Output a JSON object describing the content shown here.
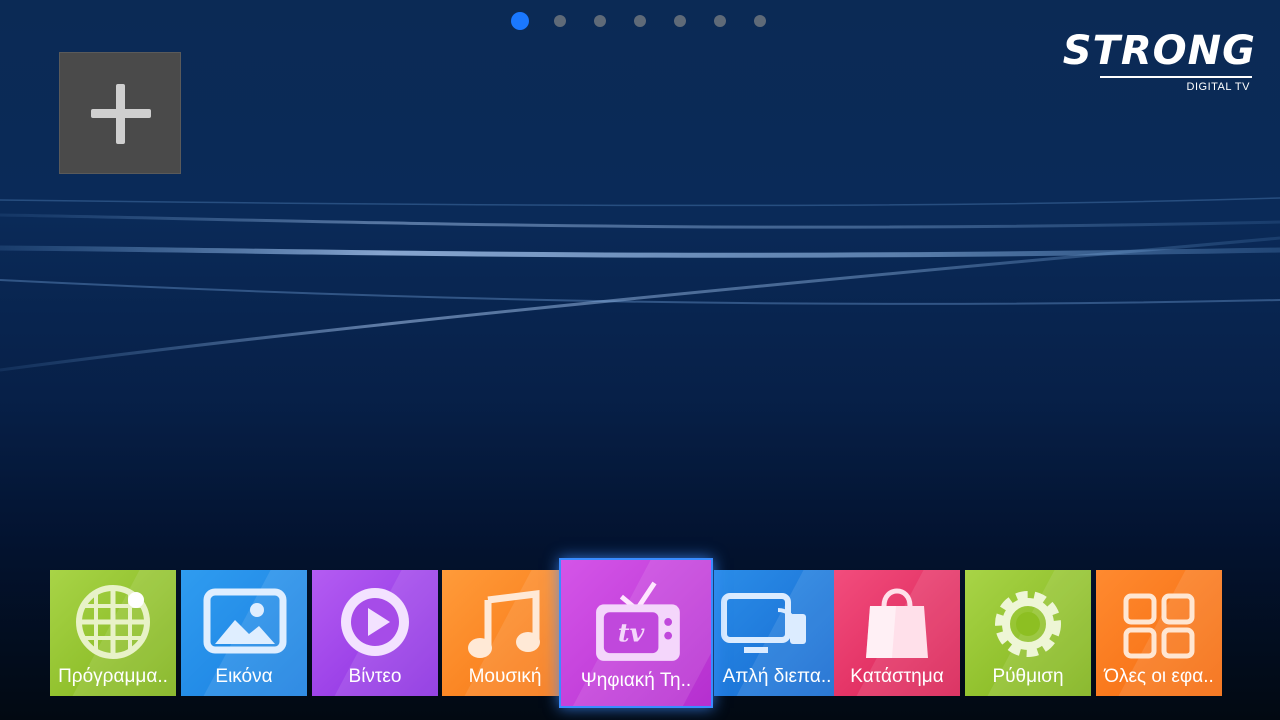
{
  "page_indicator": {
    "count": 7,
    "active_index": 0
  },
  "add_tile": {
    "icon": "plus-icon"
  },
  "logo": {
    "brand": "STRONG",
    "subtitle": "DIGITAL TV"
  },
  "dock": {
    "focused_index": 4,
    "apps": [
      {
        "label": "Πρόγραμμα..",
        "icon": "globe-grid-icon",
        "color_top": "#a8d447",
        "color_bottom": "#7fb219"
      },
      {
        "label": "Εικόνα",
        "icon": "picture-icon",
        "color_top": "#2f9cf0",
        "color_bottom": "#1a7fe0"
      },
      {
        "label": "Βίντεο",
        "icon": "play-circle-icon",
        "color_top": "#b45cf2",
        "color_bottom": "#8a2ee0"
      },
      {
        "label": "Μουσική",
        "icon": "music-note-icon",
        "color_top": "#ff9b3a",
        "color_bottom": "#f77512"
      },
      {
        "label": "Ψηφιακή Τη..",
        "icon": "tv-icon",
        "color_top": "#d455e8",
        "color_bottom": "#b52fcf"
      },
      {
        "label": "Απλή διεπα..",
        "icon": "screen-cast-icon",
        "color_top": "#2b8de8",
        "color_bottom": "#1468cf"
      },
      {
        "label": "Κατάστημα",
        "icon": "shopping-bag-icon",
        "color_top": "#f24d7d",
        "color_bottom": "#d81f53"
      },
      {
        "label": "Ρύθμιση",
        "icon": "gear-icon",
        "color_top": "#a8d447",
        "color_bottom": "#7fb219"
      },
      {
        "label": "Όλες οι εφα..",
        "icon": "apps-grid-icon",
        "color_top": "#ff8a30",
        "color_bottom": "#f46a0c"
      }
    ]
  }
}
